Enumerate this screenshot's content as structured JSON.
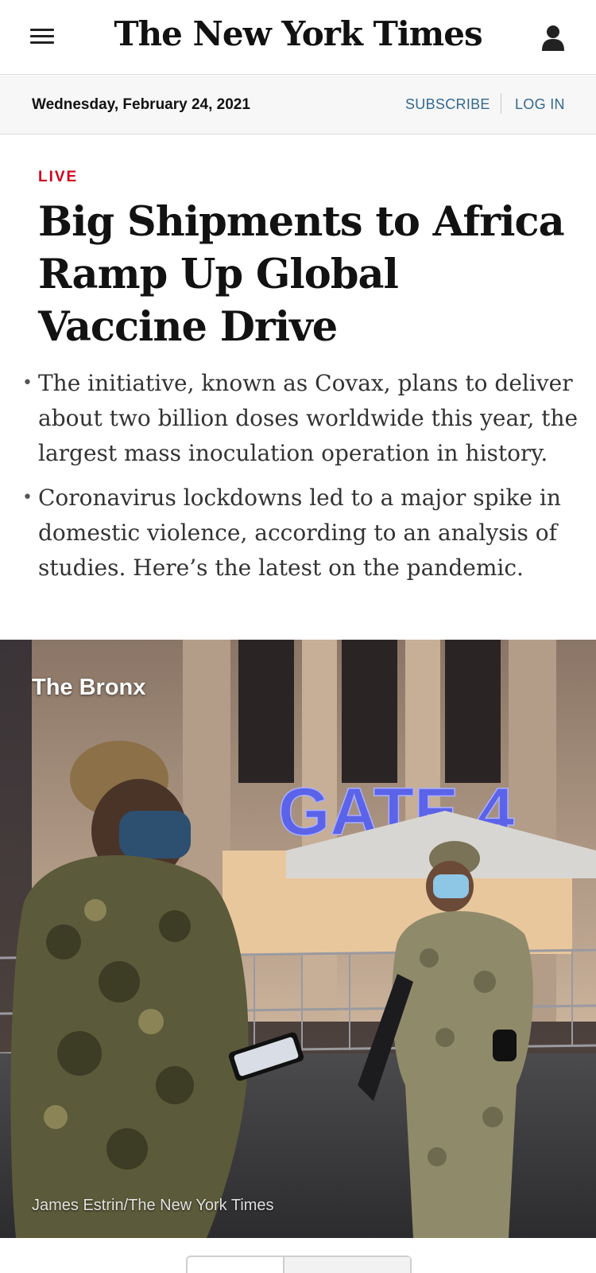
{
  "masthead": {
    "logo_text": "The New York Times",
    "menu_icon": "hamburger-menu-icon",
    "account_icon": "user-account-icon"
  },
  "datebar": {
    "date": "Wednesday, February 24, 2021",
    "subscribe_label": "SUBSCRIBE",
    "login_label": "LOG IN"
  },
  "story": {
    "kicker": "LIVE",
    "headline": "Big Shipments to Africa Ramp Up Global Vaccine Drive",
    "bullets": [
      "The initiative, known as Covax, plans to deliver about two billion doses worldwide this year, the largest mass inoculation operation in history.",
      "Coronavirus lockdowns led to a major spike in domestic violence, according to an analysis of studies. Here’s the latest on the pandemic."
    ]
  },
  "photo": {
    "label": "The Bronx",
    "sign_text": "GATE 4",
    "credit": "James Estrin/The New York Times"
  },
  "colors": {
    "live_red": "#d0021b",
    "link_blue": "#326891",
    "text": "#121212"
  }
}
